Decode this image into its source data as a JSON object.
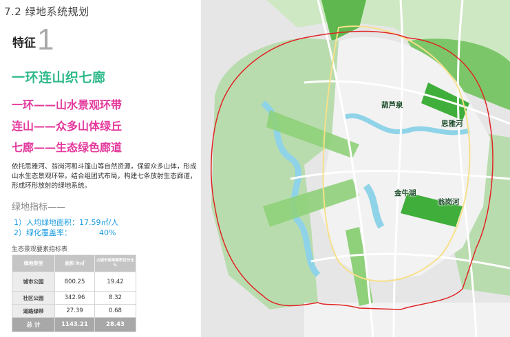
{
  "section_title": "7.2 绿地系统规划",
  "feature": {
    "label": "特征",
    "number": "1"
  },
  "headline": "一环连山织七廊",
  "subheads": [
    "一环——山水景观环带",
    "连山——众多山体绿丘",
    "七廊——生态绿色廊道"
  ],
  "description": "依托思雅河、翁岗河和斗篷山等自然资源，保留众多山体，形成山水生态景观环带。结合组团式布局，构建七条放射生态廊道，形成环形放射的绿地系统。",
  "indicators": {
    "title": "绿地指标——",
    "items": [
      {
        "label": "1）人均绿地面积：17.59㎡/人",
        "value": ""
      },
      {
        "label": "2）绿化覆盖率：",
        "value": "40%"
      }
    ]
  },
  "table": {
    "title": "生态景观要素指标表",
    "headers": [
      "绿地类型",
      "面积 h㎡",
      "占城市用地面积百分比 %"
    ],
    "rows": [
      {
        "type": "城市公园",
        "area": "800.25",
        "percent": "19.42"
      },
      {
        "type": "社区公园",
        "area": "342.96",
        "percent": "8.32"
      },
      {
        "type": "道路绿带",
        "area": "27.39",
        "percent": "0.68"
      }
    ],
    "total": {
      "type": "总 计",
      "area": "1143.21",
      "percent": "28.43"
    }
  },
  "map": {
    "labels": [
      "葫芦泉",
      "思雅河",
      "金牛湖",
      "翁岗河"
    ],
    "colors": {
      "boundary": "#e02424",
      "water": "#8fd3e8",
      "green": "#3fae3a",
      "light_green": "#a9d99a"
    }
  }
}
